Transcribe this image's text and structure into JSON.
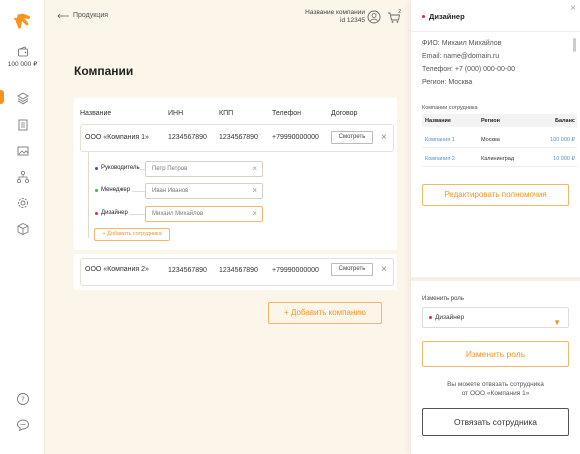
{
  "colors": {
    "accent": "#f7931e",
    "manager_dot": "#4caf50",
    "head_dot": "#3f51b5",
    "designer_dot": "#e91e63"
  },
  "sidebar": {
    "wallet_amount": "100 000 ₽"
  },
  "topbar": {
    "back_label": "Продукция",
    "company_name": "Название компании",
    "company_id": "id 12345",
    "cart_count": "2"
  },
  "main": {
    "title": "Компании",
    "columns": [
      "Название",
      "ИНН",
      "КПП",
      "Телефон",
      "Договор"
    ],
    "companies": [
      {
        "name": "ООО «Компания 1»",
        "inn": "1234567890",
        "kpp": "1234567890",
        "phone": "+79990000000",
        "view_label": "Смотреть"
      },
      {
        "name": "ООО «Компания 2»",
        "inn": "1234567890",
        "kpp": "1234567890",
        "phone": "+79990000000",
        "view_label": "Смотреть"
      }
    ],
    "employees": [
      {
        "role": "Руководитель",
        "name": "Петр Петров"
      },
      {
        "role": "Менеджер",
        "name": "Иван Иванов"
      },
      {
        "role": "Дизайнер",
        "name": "Михаил Михайлов"
      }
    ],
    "add_employee_label": "+ Добавить сотрудника",
    "add_company_label": "+ Добавить компанию"
  },
  "panel": {
    "title": "Дизайнер",
    "info": [
      "ФИО: Михаил Михайлов",
      "Email: name@domain.ru",
      "Телефон: +7 (000) 000-00-00",
      "Регион: Москва"
    ],
    "companies_caption": "Компании сотрудника",
    "table_headers": [
      "Название",
      "Регион",
      "Баланс"
    ],
    "table_rows": [
      {
        "name": "Компания 1",
        "region": "Москва",
        "balance": "100 000 ₽"
      },
      {
        "name": "Компания 2",
        "region": "Калининград",
        "balance": "10 000 ₽"
      }
    ],
    "edit_permissions_label": "Редактировать полномочия",
    "change_role_caption": "Изменить роль",
    "selected_role": "Дизайнер",
    "change_role_button": "Изменить роль",
    "unbind_note_line1": "Вы можете отвязать сотрудника",
    "unbind_note_line2": "от ООО «Компания 1»",
    "unbind_button": "Отвязать сотрудника"
  }
}
